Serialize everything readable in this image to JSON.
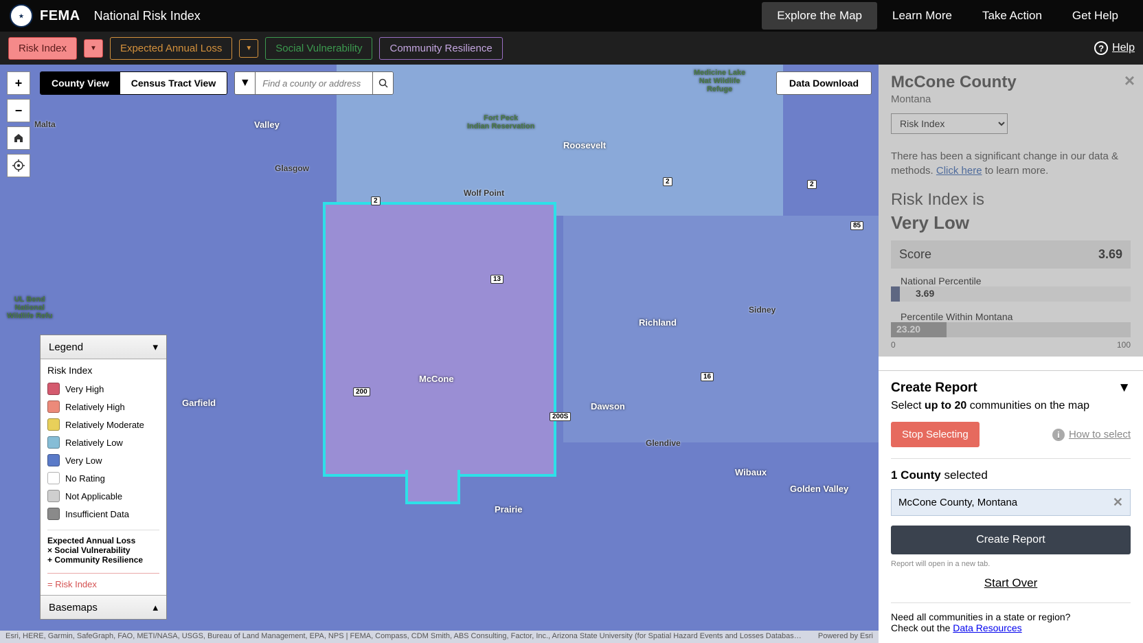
{
  "header": {
    "agency": "FEMA",
    "title": "National Risk Index",
    "nav": [
      "Explore the Map",
      "Learn More",
      "Take Action",
      "Get Help"
    ],
    "active_nav": 0,
    "color_squares": [
      "#5a8a5a",
      "#5a7aa8",
      "#d4b44a",
      "#e0843c",
      "#d86a5a",
      "#9a6a9a"
    ]
  },
  "filters": {
    "risk_index": "Risk Index",
    "eal": "Expected Annual Loss",
    "sv": "Social Vulnerability",
    "cr": "Community Resilience",
    "help": "Help"
  },
  "map_controls": {
    "county_view": "County View",
    "tract_view": "Census Tract View",
    "search_placeholder": "Find a county or address",
    "data_download": "Data Download"
  },
  "legend": {
    "title": "Legend",
    "section": "Risk Index",
    "items": [
      {
        "label": "Very High",
        "color": "#d45a6e"
      },
      {
        "label": "Relatively High",
        "color": "#ec8a7a"
      },
      {
        "label": "Relatively Moderate",
        "color": "#e8d05a"
      },
      {
        "label": "Relatively Low",
        "color": "#86bdd6"
      },
      {
        "label": "Very Low",
        "color": "#5a7ac8"
      },
      {
        "label": "No Rating",
        "color": "#ffffff"
      },
      {
        "label": "Not Applicable",
        "color": "#cfcfcf"
      },
      {
        "label": "Insufficient Data",
        "color": "#8a8a8a"
      }
    ],
    "formula": {
      "l1": "Expected Annual Loss",
      "l2": "× Social Vulnerability",
      "l3": "+ Community Resilience"
    },
    "eq": "= Risk Index",
    "basemaps": "Basemaps"
  },
  "map_labels": {
    "valley": "Valley",
    "roosevelt": "Roosevelt",
    "richland": "Richland",
    "mccone": "McCone",
    "garfield": "Garfield",
    "dawson": "Dawson",
    "prairie": "Prairie",
    "wibaux": "Wibaux",
    "golden_valley": "Golden Valley",
    "malta": "Malta",
    "glasgow": "Glasgow",
    "wolf_point": "Wolf Point",
    "sidney": "Sidney",
    "glendive": "Glendive",
    "fort_peck": "Fort Peck\nIndian Reservation",
    "medicine_lake": "Medicine Lake\nNat Wildlife\nRefuge",
    "ul_bend": "UL Bend\nNational\nWildlife Refu",
    "routes": {
      "r2a": "2",
      "r2b": "2",
      "r2c": "2",
      "r13": "13",
      "r16": "16",
      "r200": "200",
      "r200s": "200S",
      "r85": "85"
    }
  },
  "attribution": {
    "left": "Esri, HERE, Garmin, SafeGraph, FAO, METI/NASA, USGS, Bureau of Land Management, EPA, NPS | FEMA, Compass, CDM Smith, ABS Consulting, Factor, Inc., Arizona State University (for Spatial Hazard Events and Losses Databas…",
    "right": "Powered by Esri"
  },
  "sidebar": {
    "county": "McCone County",
    "state": "Montana",
    "select_value": "Risk Index",
    "notice_pre": "There has been a significant change in our data & methods. ",
    "notice_link": "Click here",
    "notice_post": " to learn more.",
    "risk_label": "Risk Index is",
    "risk_value": "Very Low",
    "score_label": "Score",
    "score_value": "3.69",
    "nat_pct_label": "National Percentile",
    "nat_pct": "3.69",
    "state_pct_label": "Percentile Within Montana",
    "state_pct": "23.20",
    "scale_min": "0",
    "scale_max": "100"
  },
  "report": {
    "title": "Create Report",
    "sub_pre": "Select ",
    "sub_bold": "up to 20",
    "sub_post": " communities on the map",
    "stop": "Stop Selecting",
    "howto": "How to select",
    "count_n": "1 County",
    "count_post": " selected",
    "selected_item": "McCone County, Montana",
    "create": "Create Report",
    "note": "Report will open in a new tab.",
    "start_over": "Start Over",
    "footer_q": "Need all communities in a state or region?",
    "footer_pre": "Check out the ",
    "footer_link": "Data Resources"
  }
}
